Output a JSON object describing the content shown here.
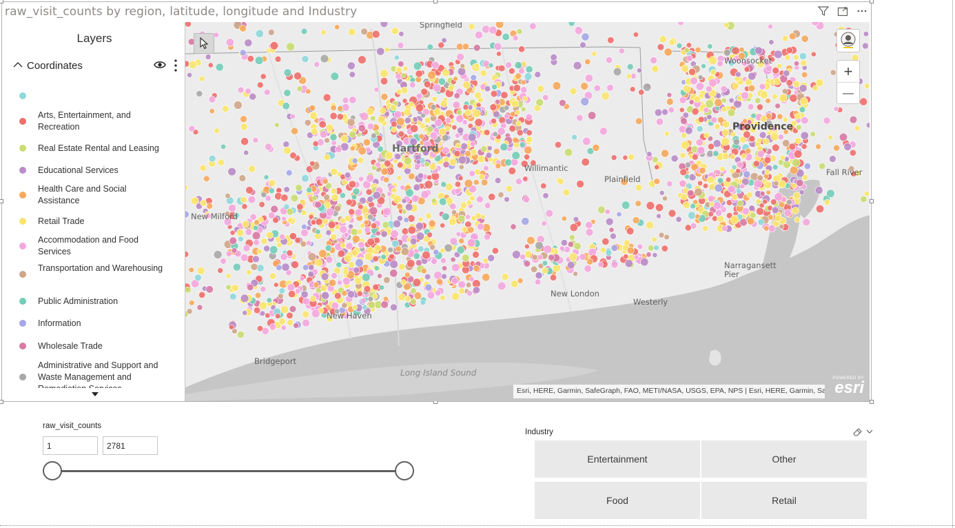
{
  "visual": {
    "title": "raw_visit_counts by region, latitude, longitude and Industry",
    "header_icons": [
      "filter-icon",
      "focus-mode-icon",
      "more-options-icon"
    ]
  },
  "legend": {
    "title": "Layers",
    "layer_name": "Coordinates",
    "items": [
      {
        "label": "",
        "color": "#8fd8dc"
      },
      {
        "label": "Arts, Entertainment, and Recreation",
        "color": "#ef6f6c"
      },
      {
        "label": "Real Estate Rental and Leasing",
        "color": "#c9dd71"
      },
      {
        "label": "Educational Services",
        "color": "#b98cc8"
      },
      {
        "label": "Health Care and Social Assistance",
        "color": "#f7a85b"
      },
      {
        "label": "Retail Trade",
        "color": "#f9e56c"
      },
      {
        "label": "Accommodation and Food Services",
        "color": "#f4a7df"
      },
      {
        "label": "Transportation and Warehousing",
        "color": "#cfa689"
      },
      {
        "label": "Public Administration",
        "color": "#73cdb8"
      },
      {
        "label": "Information",
        "color": "#a6a6e8"
      },
      {
        "label": "Wholesale Trade",
        "color": "#d77aa4"
      },
      {
        "label": "Administrative and Support and Waste Management and Remediation Services",
        "color": "#a8a8a8"
      }
    ]
  },
  "map": {
    "labels": {
      "springfield": "Springfield",
      "hartford": "Hartford",
      "providence": "Providence",
      "willimantic": "Willimantic",
      "plainfield": "Plainfield",
      "fall_river": "Fall River",
      "new_milford": "New Milford",
      "narragansett": "Narragansett Pier",
      "long_island_sound": "Long Island Sound",
      "new_london": "New London",
      "westerly": "Westerly",
      "new_haven": "New Haven",
      "bridgeport": "Bridgeport",
      "woonsocket": "Woonsocket"
    },
    "attribution": "Esri, HERE, Garmin, SafeGraph, FAO, METI/NASA, USGS, EPA, NPS | Esri, HERE, Garmin, Safe...",
    "logo_small": "POWERED BY",
    "logo_brand": "esri",
    "zoom_in": "+",
    "zoom_out": "—"
  },
  "slider": {
    "label": "raw_visit_counts",
    "min_value": "1",
    "max_value": "2781",
    "range_fraction": [
      0.0,
      1.0
    ]
  },
  "slicer": {
    "title": "Industry",
    "tiles": [
      "Entertainment",
      "Other",
      "Food",
      "Retail"
    ]
  }
}
